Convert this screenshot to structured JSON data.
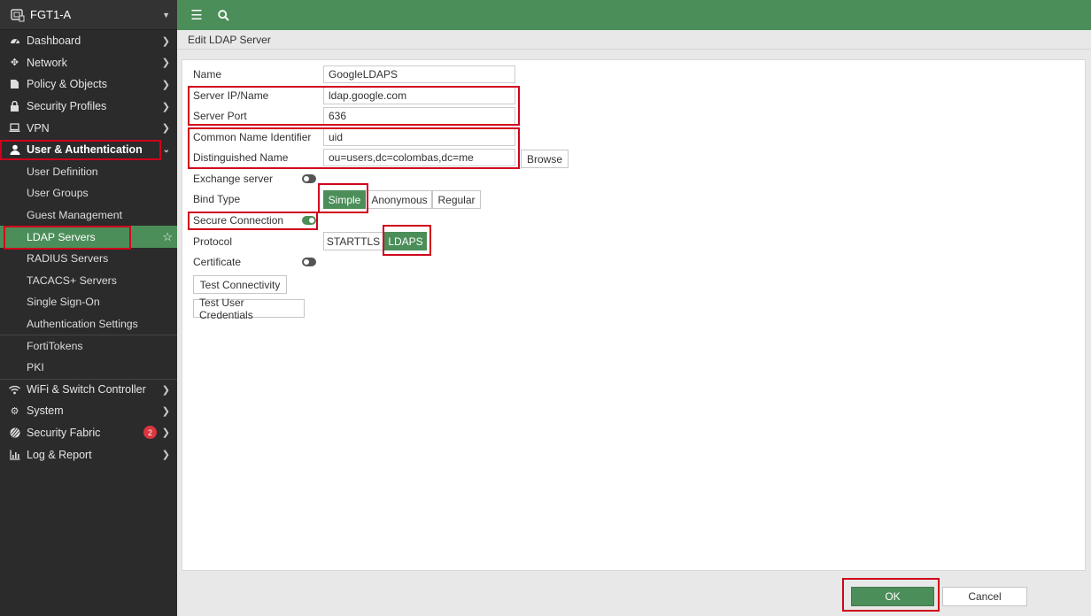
{
  "device": {
    "name": "FGT1-A"
  },
  "nav": {
    "dashboard": "Dashboard",
    "network": "Network",
    "policy": "Policy & Objects",
    "security_profiles": "Security Profiles",
    "vpn": "VPN",
    "user_auth": "User & Authentication",
    "user_definition": "User Definition",
    "user_groups": "User Groups",
    "guest_management": "Guest Management",
    "ldap_servers": "LDAP Servers",
    "radius_servers": "RADIUS Servers",
    "tacacs_servers": "TACACS+ Servers",
    "single_sign_on": "Single Sign-On",
    "auth_settings": "Authentication Settings",
    "fortitokens": "FortiTokens",
    "pki": "PKI",
    "wifi": "WiFi & Switch Controller",
    "system": "System",
    "security_fabric": "Security Fabric",
    "security_fabric_badge": "2",
    "log_report": "Log & Report"
  },
  "page": {
    "title": "Edit LDAP Server"
  },
  "form": {
    "name_label": "Name",
    "name_value": "GoogleLDAPS",
    "server_label": "Server IP/Name",
    "server_value": "ldap.google.com",
    "port_label": "Server Port",
    "port_value": "636",
    "cn_label": "Common Name Identifier",
    "cn_value": "uid",
    "dn_label": "Distinguished Name",
    "dn_value": "ou=users,dc=colombas,dc=me",
    "browse": "Browse",
    "exchange_label": "Exchange server",
    "exchange_enabled": false,
    "bind_label": "Bind Type",
    "bind_options": [
      "Simple",
      "Anonymous",
      "Regular"
    ],
    "bind_selected": "Simple",
    "secure_label": "Secure Connection",
    "secure_enabled": true,
    "protocol_label": "Protocol",
    "protocol_options": [
      "STARTTLS",
      "LDAPS"
    ],
    "protocol_selected": "LDAPS",
    "cert_label": "Certificate",
    "cert_enabled": false,
    "test_connectivity": "Test Connectivity",
    "test_credentials": "Test User Credentials"
  },
  "footer": {
    "ok": "OK",
    "cancel": "Cancel"
  },
  "colors": {
    "accent": "#4b8e59",
    "sidebar": "#2b2b2b",
    "highlight": "#d0021b",
    "badge": "#d9363e"
  }
}
